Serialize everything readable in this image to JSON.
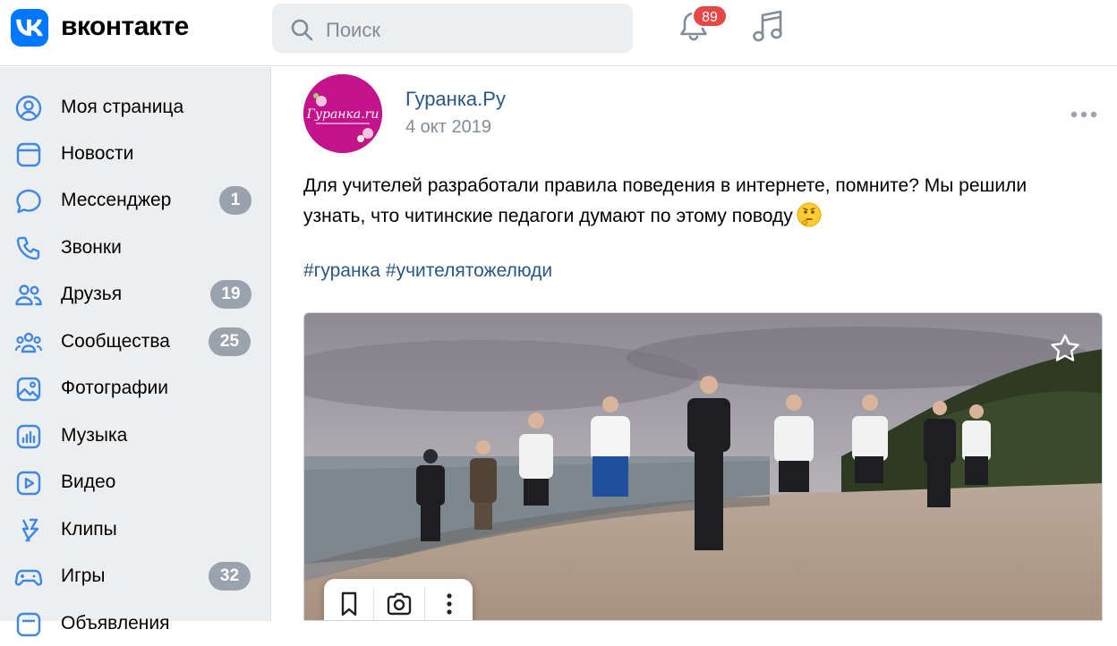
{
  "header": {
    "brand": "вконтакте",
    "search_placeholder": "Поиск",
    "notifications_count": "89"
  },
  "sidebar": {
    "items": [
      {
        "label": "Моя страница",
        "icon": "user-circle-icon",
        "count": ""
      },
      {
        "label": "Новости",
        "icon": "news-icon",
        "count": ""
      },
      {
        "label": "Мессенджер",
        "icon": "message-icon",
        "count": "1"
      },
      {
        "label": "Звонки",
        "icon": "phone-icon",
        "count": ""
      },
      {
        "label": "Друзья",
        "icon": "friends-icon",
        "count": "19"
      },
      {
        "label": "Сообщества",
        "icon": "communities-icon",
        "count": "25"
      },
      {
        "label": "Фотографии",
        "icon": "photo-icon",
        "count": ""
      },
      {
        "label": "Музыка",
        "icon": "music-icon",
        "count": ""
      },
      {
        "label": "Видео",
        "icon": "video-icon",
        "count": ""
      },
      {
        "label": "Клипы",
        "icon": "clips-icon",
        "count": ""
      },
      {
        "label": "Игры",
        "icon": "games-icon",
        "count": "32"
      },
      {
        "label": "Объявления",
        "icon": "ads-icon",
        "count": ""
      }
    ]
  },
  "post": {
    "author": "Гуранка.Ру",
    "date": "4 окт 2019",
    "text_line1": "Для учителей разработали правила поведения в интернете, помните? Мы решили",
    "text_line2": "узнать, что читинские педагоги думают по этому поводу",
    "emoji": "thinking-face-icon",
    "hashtags": [
      "#гуранка",
      "#учителятожелюди"
    ],
    "avatar_text": "Гуранка.ru"
  },
  "colors": {
    "accent": "#0077ff",
    "link": "#2a5885",
    "badge_red": "#e64646",
    "counter_grey": "#99a2ad",
    "sidebar_bg": "#edeef0",
    "avatar_bg": "#c4138a"
  }
}
